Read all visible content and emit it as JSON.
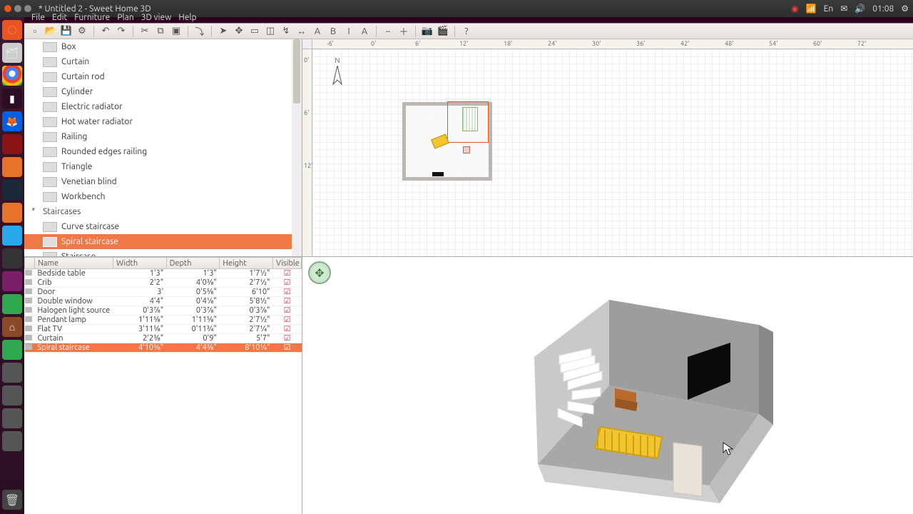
{
  "panel": {
    "title": "* Untitled 2 - Sweet Home 3D",
    "lang": "En",
    "time": "01:08"
  },
  "menu": [
    "File",
    "Edit",
    "Furniture",
    "Plan",
    "3D view",
    "Help"
  ],
  "toolbar": [
    {
      "name": "new-icon",
      "g": "▫"
    },
    {
      "name": "open-icon",
      "g": "📂"
    },
    {
      "name": "save-icon",
      "g": "💾"
    },
    {
      "name": "preferences-icon",
      "g": "⚙"
    },
    {
      "sep": true
    },
    {
      "name": "undo-icon",
      "g": "↶"
    },
    {
      "name": "redo-icon",
      "g": "↷"
    },
    {
      "sep": true
    },
    {
      "name": "cut-icon",
      "g": "✂"
    },
    {
      "name": "copy-icon",
      "g": "⧉"
    },
    {
      "name": "paste-icon",
      "g": "▣"
    },
    {
      "sep": true
    },
    {
      "name": "import-icon",
      "g": "⤵"
    },
    {
      "sep": true
    },
    {
      "name": "select-icon",
      "g": "➤"
    },
    {
      "name": "pan-icon",
      "g": "✥"
    },
    {
      "name": "wall-icon",
      "g": "▭"
    },
    {
      "name": "room-icon",
      "g": "◫"
    },
    {
      "name": "polyline-icon",
      "g": "↯"
    },
    {
      "name": "dimension-icon",
      "g": "↔"
    },
    {
      "name": "text-icon",
      "g": "A"
    },
    {
      "name": "bold-icon",
      "g": "B"
    },
    {
      "name": "italic-icon",
      "g": "I"
    },
    {
      "name": "font-icon",
      "g": "A"
    },
    {
      "sep": true
    },
    {
      "name": "zoom-out-icon",
      "g": "−"
    },
    {
      "name": "zoom-in-icon",
      "g": "＋"
    },
    {
      "sep": true
    },
    {
      "name": "photo-icon",
      "g": "📷"
    },
    {
      "name": "video-icon",
      "g": "🎬"
    },
    {
      "sep": true
    },
    {
      "name": "help-icon",
      "g": "?"
    }
  ],
  "catalog": {
    "items": [
      {
        "label": "Box"
      },
      {
        "label": "Curtain"
      },
      {
        "label": "Curtain rod"
      },
      {
        "label": "Cylinder"
      },
      {
        "label": "Electric radiator"
      },
      {
        "label": "Hot water radiator"
      },
      {
        "label": "Railing"
      },
      {
        "label": "Rounded edges railing"
      },
      {
        "label": "Triangle"
      },
      {
        "label": "Venetian blind"
      },
      {
        "label": "Workbench"
      }
    ],
    "category": "Staircases",
    "stairs": [
      {
        "label": "Curve staircase"
      },
      {
        "label": "Spiral staircase",
        "selected": true
      },
      {
        "label": "Staircase"
      }
    ]
  },
  "table": {
    "cols": [
      "Name",
      "Width",
      "Depth",
      "Height",
      "Visible"
    ],
    "rows": [
      {
        "name": "Bedside table",
        "w": "1'3\"",
        "d": "1'3\"",
        "h": "1'7½\"",
        "v": true
      },
      {
        "name": "Crib",
        "w": "2'2\"",
        "d": "4'0⅜\"",
        "h": "2'7½\"",
        "v": true
      },
      {
        "name": "Door",
        "w": "3'",
        "d": "0'5⅝\"",
        "h": "6'10\"",
        "v": true
      },
      {
        "name": "Double window",
        "w": "4'4\"",
        "d": "0'4⅛\"",
        "h": "5'8½\"",
        "v": true
      },
      {
        "name": "Halogen light source",
        "w": "0'3⅞\"",
        "d": "0'3⅞\"",
        "h": "0'3⅞\"",
        "v": true
      },
      {
        "name": "Pendant lamp",
        "w": "1'11⅝\"",
        "d": "1'11⅝\"",
        "h": "2'7½\"",
        "v": true
      },
      {
        "name": "Flat TV",
        "w": "3'11⅝\"",
        "d": "0'11¾\"",
        "h": "2'7¼\"",
        "v": true
      },
      {
        "name": "Curtain",
        "w": "2'2⅜\"",
        "d": "0'9\"",
        "h": "5'7\"",
        "v": true
      },
      {
        "name": "Spiral staircase",
        "w": "4'10⅜\"",
        "d": "4'4⅜\"",
        "h": "8'10¼\"",
        "v": true,
        "selected": true
      }
    ]
  },
  "ruler_h": [
    "-6'",
    "0'",
    "6'",
    "12'",
    "18'",
    "24'",
    "30'",
    "36'",
    "42'",
    "48'",
    "54'",
    "60'",
    "72'"
  ],
  "ruler_v": [
    "0'",
    "6'",
    "12'"
  ],
  "compass_n": "N"
}
